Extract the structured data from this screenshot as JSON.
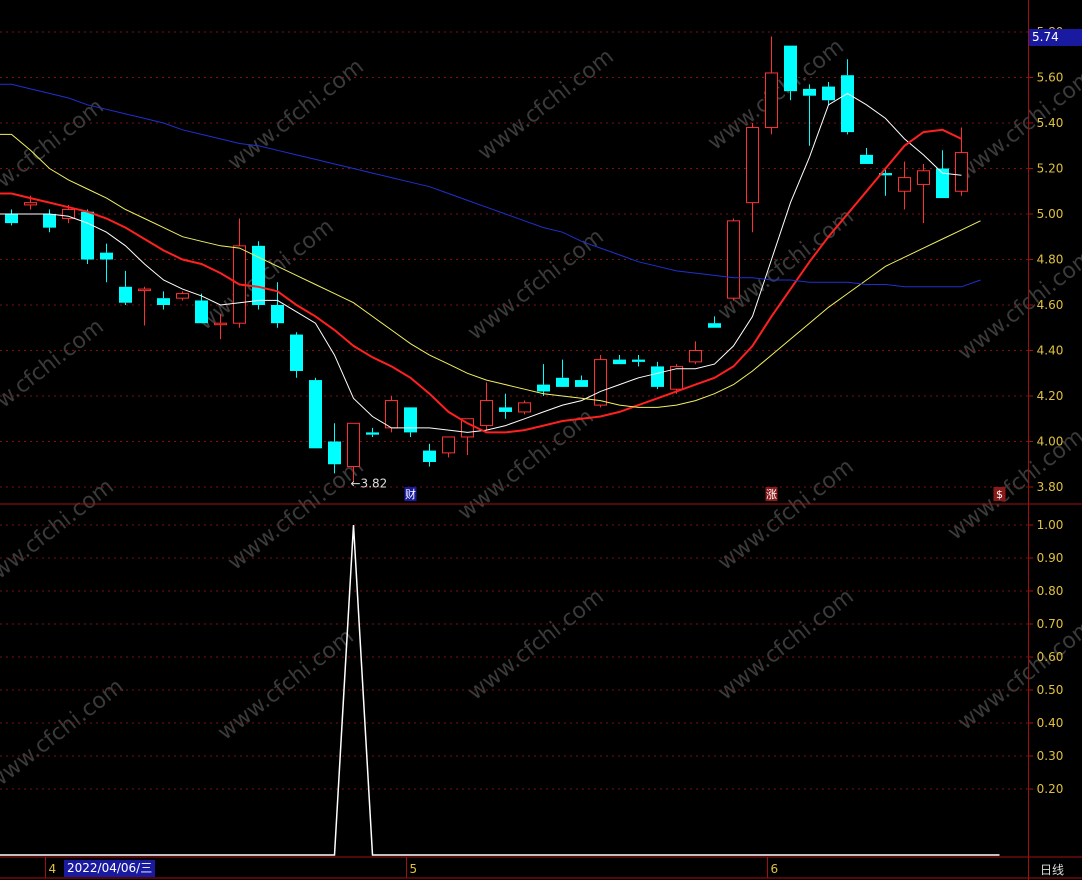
{
  "chart_data": {
    "type": "candlestick",
    "main_panel": {
      "y_range": [
        3.72,
        5.84
      ],
      "y_ticks": [
        "5.80",
        "5.60",
        "5.40",
        "5.20",
        "5.00",
        "4.80",
        "4.60",
        "4.40",
        "4.20",
        "4.00",
        "3.80"
      ],
      "current_price": "5.74",
      "low_marker": "←3.82",
      "event_markers": [
        {
          "index": 21,
          "label": "财",
          "color": "#1a1aa0"
        },
        {
          "index": 40,
          "label": "涨",
          "color": "#8b1a1a"
        },
        {
          "index": 52,
          "label": "$",
          "color": "#8b1a1a"
        }
      ],
      "candles": [
        {
          "o": 5.0,
          "h": 5.02,
          "l": 4.95,
          "c": 4.96
        },
        {
          "o": 5.04,
          "h": 5.08,
          "l": 5.02,
          "c": 5.05
        },
        {
          "o": 5.0,
          "h": 5.02,
          "l": 4.92,
          "c": 4.94
        },
        {
          "o": 4.98,
          "h": 5.04,
          "l": 4.96,
          "c": 5.02
        },
        {
          "o": 5.01,
          "h": 5.02,
          "l": 4.78,
          "c": 4.8
        },
        {
          "o": 4.83,
          "h": 4.87,
          "l": 4.7,
          "c": 4.8
        },
        {
          "o": 4.68,
          "h": 4.75,
          "l": 4.6,
          "c": 4.61
        },
        {
          "o": 4.67,
          "h": 4.68,
          "l": 4.51,
          "c": 4.67
        },
        {
          "o": 4.63,
          "h": 4.66,
          "l": 4.58,
          "c": 4.6
        },
        {
          "o": 4.63,
          "h": 4.66,
          "l": 4.62,
          "c": 4.65
        },
        {
          "o": 4.62,
          "h": 4.65,
          "l": 4.52,
          "c": 4.52
        },
        {
          "o": 4.52,
          "h": 4.56,
          "l": 4.45,
          "c": 4.52
        },
        {
          "o": 4.52,
          "h": 4.98,
          "l": 4.5,
          "c": 4.86
        },
        {
          "o": 4.86,
          "h": 4.88,
          "l": 4.58,
          "c": 4.6
        },
        {
          "o": 4.6,
          "h": 4.7,
          "l": 4.5,
          "c": 4.52
        },
        {
          "o": 4.47,
          "h": 4.48,
          "l": 4.28,
          "c": 4.31
        },
        {
          "o": 4.27,
          "h": 4.28,
          "l": 3.97,
          "c": 3.97
        },
        {
          "o": 4.0,
          "h": 4.08,
          "l": 3.86,
          "c": 3.9
        },
        {
          "o": 3.89,
          "h": 4.08,
          "l": 3.82,
          "c": 4.08
        },
        {
          "o": 4.04,
          "h": 4.06,
          "l": 4.02,
          "c": 4.03
        },
        {
          "o": 4.06,
          "h": 4.2,
          "l": 4.04,
          "c": 4.18
        },
        {
          "o": 4.15,
          "h": 4.15,
          "l": 4.02,
          "c": 4.04
        },
        {
          "o": 3.96,
          "h": 3.99,
          "l": 3.89,
          "c": 3.91
        },
        {
          "o": 3.95,
          "h": 4.02,
          "l": 3.93,
          "c": 4.02
        },
        {
          "o": 4.02,
          "h": 4.1,
          "l": 3.94,
          "c": 4.1
        },
        {
          "o": 4.07,
          "h": 4.26,
          "l": 4.05,
          "c": 4.18
        },
        {
          "o": 4.15,
          "h": 4.21,
          "l": 4.1,
          "c": 4.13
        },
        {
          "o": 4.13,
          "h": 4.18,
          "l": 4.12,
          "c": 4.17
        },
        {
          "o": 4.25,
          "h": 4.34,
          "l": 4.2,
          "c": 4.22
        },
        {
          "o": 4.28,
          "h": 4.36,
          "l": 4.26,
          "c": 4.24
        },
        {
          "o": 4.27,
          "h": 4.29,
          "l": 4.24,
          "c": 4.24
        },
        {
          "o": 4.16,
          "h": 4.38,
          "l": 4.15,
          "c": 4.36
        },
        {
          "o": 4.36,
          "h": 4.38,
          "l": 4.34,
          "c": 4.34
        },
        {
          "o": 4.36,
          "h": 4.38,
          "l": 4.33,
          "c": 4.35
        },
        {
          "o": 4.33,
          "h": 4.35,
          "l": 4.23,
          "c": 4.24
        },
        {
          "o": 4.23,
          "h": 4.34,
          "l": 4.21,
          "c": 4.33
        },
        {
          "o": 4.35,
          "h": 4.44,
          "l": 4.34,
          "c": 4.4
        },
        {
          "o": 4.52,
          "h": 4.55,
          "l": 4.5,
          "c": 4.5
        },
        {
          "o": 4.63,
          "h": 4.98,
          "l": 4.62,
          "c": 4.97
        },
        {
          "o": 5.05,
          "h": 5.4,
          "l": 4.92,
          "c": 5.38
        },
        {
          "o": 5.38,
          "h": 5.78,
          "l": 5.35,
          "c": 5.62
        },
        {
          "o": 5.74,
          "h": 5.74,
          "l": 5.5,
          "c": 5.54
        },
        {
          "o": 5.55,
          "h": 5.57,
          "l": 5.3,
          "c": 5.52
        },
        {
          "o": 5.56,
          "h": 5.58,
          "l": 5.48,
          "c": 5.5
        },
        {
          "o": 5.61,
          "h": 5.68,
          "l": 5.35,
          "c": 5.36
        },
        {
          "o": 5.26,
          "h": 5.29,
          "l": 5.22,
          "c": 5.22
        },
        {
          "o": 5.18,
          "h": 5.2,
          "l": 5.08,
          "c": 5.17
        },
        {
          "o": 5.1,
          "h": 5.23,
          "l": 5.02,
          "c": 5.16
        },
        {
          "o": 5.13,
          "h": 5.22,
          "l": 4.96,
          "c": 5.19
        },
        {
          "o": 5.2,
          "h": 5.28,
          "l": 5.07,
          "c": 5.07
        },
        {
          "o": 5.1,
          "h": 5.38,
          "l": 5.08,
          "c": 5.27
        }
      ],
      "lines": [
        {
          "name": "MA5",
          "color": "#ffffff",
          "values": [
            5.0,
            5.0,
            5.0,
            4.99,
            4.96,
            4.92,
            4.86,
            4.78,
            4.71,
            4.67,
            4.64,
            4.6,
            4.61,
            4.62,
            4.62,
            4.57,
            4.52,
            4.38,
            4.19,
            4.11,
            4.06,
            4.06,
            4.06,
            4.05,
            4.04,
            4.05,
            4.07,
            4.1,
            4.13,
            4.16,
            4.18,
            4.22,
            4.25,
            4.28,
            4.3,
            4.32,
            4.32,
            4.34,
            4.42,
            4.55,
            4.8,
            5.05,
            5.25,
            5.48,
            5.53,
            5.48,
            5.42,
            5.33,
            5.26,
            5.18,
            5.17
          ]
        },
        {
          "name": "MA10",
          "color": "#ff2020",
          "values": [
            5.09,
            5.07,
            5.05,
            5.03,
            5.01,
            4.98,
            4.94,
            4.89,
            4.84,
            4.8,
            4.78,
            4.74,
            4.69,
            4.68,
            4.66,
            4.6,
            4.55,
            4.49,
            4.42,
            4.37,
            4.33,
            4.28,
            4.21,
            4.13,
            4.08,
            4.04,
            4.04,
            4.05,
            4.07,
            4.09,
            4.1,
            4.11,
            4.13,
            4.16,
            4.19,
            4.22,
            4.25,
            4.28,
            4.33,
            4.42,
            4.55,
            4.67,
            4.79,
            4.9,
            5.0,
            5.1,
            5.2,
            5.3,
            5.36,
            5.37,
            5.33
          ]
        },
        {
          "name": "MA20",
          "color": "#f0f060",
          "values": [
            5.35,
            5.28,
            5.2,
            5.15,
            5.11,
            5.07,
            5.02,
            4.98,
            4.94,
            4.9,
            4.88,
            4.86,
            4.85,
            4.81,
            4.77,
            4.73,
            4.69,
            4.65,
            4.61,
            4.55,
            4.49,
            4.43,
            4.38,
            4.34,
            4.3,
            4.27,
            4.25,
            4.23,
            4.21,
            4.2,
            4.19,
            4.18,
            4.16,
            4.15,
            4.15,
            4.16,
            4.18,
            4.21,
            4.25,
            4.31,
            4.38,
            4.45,
            4.52,
            4.59,
            4.65,
            4.71,
            4.77,
            4.81,
            4.85,
            4.89,
            4.93,
            4.97
          ]
        },
        {
          "name": "MA60",
          "color": "#2030d0",
          "values": [
            5.57,
            5.55,
            5.53,
            5.51,
            5.48,
            5.46,
            5.44,
            5.42,
            5.4,
            5.37,
            5.35,
            5.33,
            5.31,
            5.3,
            5.28,
            5.26,
            5.24,
            5.22,
            5.2,
            5.18,
            5.16,
            5.14,
            5.12,
            5.09,
            5.06,
            5.03,
            5.0,
            4.97,
            4.94,
            4.92,
            4.88,
            4.85,
            4.82,
            4.79,
            4.77,
            4.75,
            4.74,
            4.73,
            4.72,
            4.72,
            4.71,
            4.71,
            4.7,
            4.7,
            4.7,
            4.69,
            4.69,
            4.68,
            4.68,
            4.68,
            4.68,
            4.71
          ]
        }
      ]
    },
    "sub_panel": {
      "y_range": [
        0,
        1.05
      ],
      "y_ticks": [
        "1.00",
        "0.90",
        "0.80",
        "0.70",
        "0.60",
        "0.50",
        "0.40",
        "0.30",
        "0.20"
      ],
      "series": [
        {
          "color": "#ffffff",
          "values": [
            0,
            0,
            0,
            0,
            0,
            0,
            0,
            0,
            0,
            0,
            0,
            0,
            0,
            0,
            0,
            0,
            0,
            0,
            1,
            0,
            0,
            0,
            0,
            0,
            0,
            0,
            0,
            0,
            0,
            0,
            0,
            0,
            0,
            0,
            0,
            0,
            0,
            0,
            0,
            0,
            0,
            0,
            0,
            0,
            0,
            0,
            0,
            0,
            0,
            0,
            0,
            0,
            0
          ]
        }
      ]
    },
    "x_axis": {
      "month_labels": [
        {
          "index": 2,
          "label": "4"
        },
        {
          "index": 21,
          "label": "5"
        },
        {
          "index": 40,
          "label": "6"
        }
      ],
      "cursor_date": "2022/04/06/三",
      "period": "日线"
    },
    "watermark": "www.cfchi.com"
  }
}
